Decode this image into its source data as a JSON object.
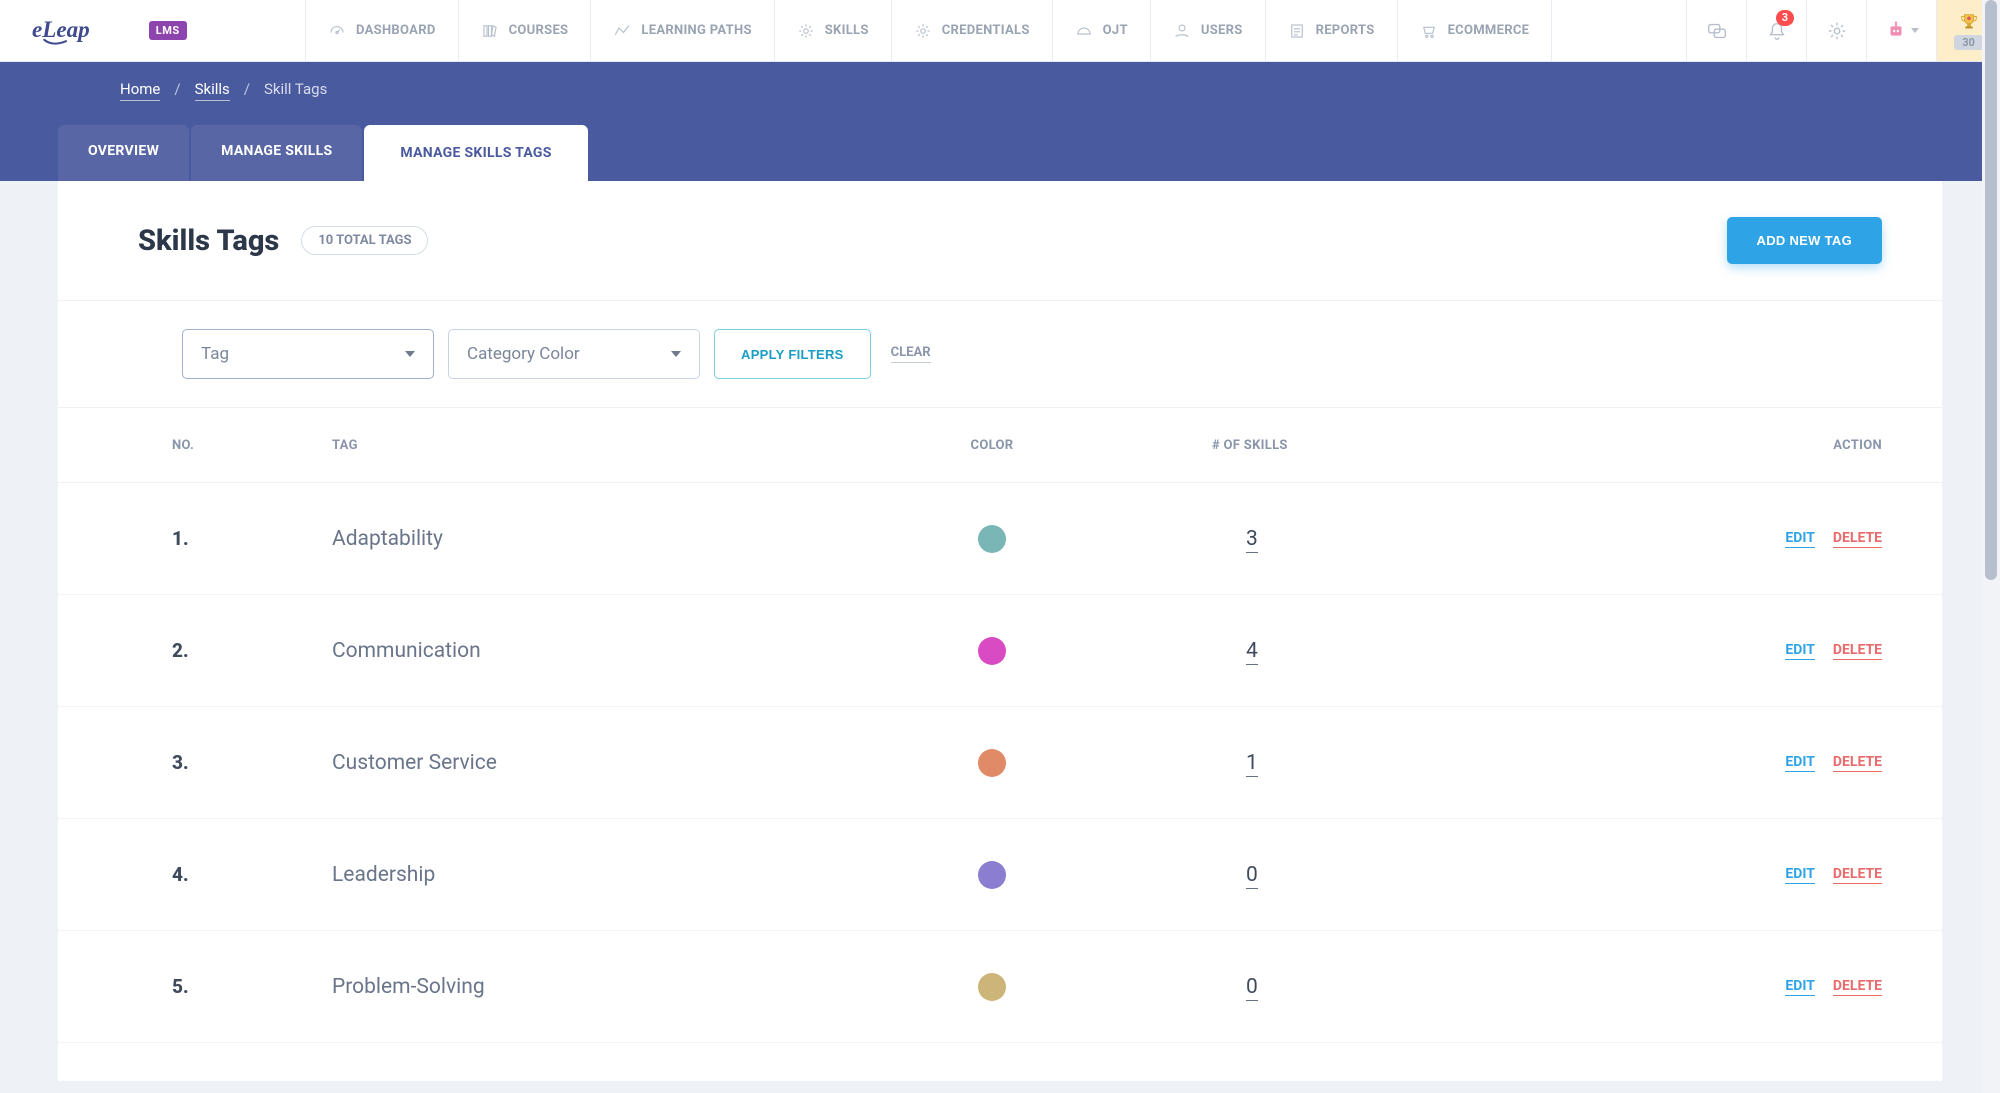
{
  "brand": {
    "lms_badge": "LMS"
  },
  "nav": [
    {
      "label": "DASHBOARD",
      "icon": "gauge-icon"
    },
    {
      "label": "COURSES",
      "icon": "books-icon"
    },
    {
      "label": "LEARNING PATHS",
      "icon": "path-icon"
    },
    {
      "label": "SKILLS",
      "icon": "gear-icon"
    },
    {
      "label": "CREDENTIALS",
      "icon": "gear-icon"
    },
    {
      "label": "OJT",
      "icon": "helmet-icon"
    },
    {
      "label": "USERS",
      "icon": "user-icon"
    },
    {
      "label": "REPORTS",
      "icon": "report-icon"
    },
    {
      "label": "ECOMMERCE",
      "icon": "cart-icon"
    }
  ],
  "notifications_count": "3",
  "trophy_count": "30",
  "breadcrumb": {
    "home": "Home",
    "skills": "Skills",
    "current": "Skill Tags"
  },
  "tabs": {
    "overview": "OVERVIEW",
    "manage_skills": "MANAGE SKILLS",
    "manage_tags": "MANAGE SKILLS TAGS"
  },
  "page": {
    "title": "Skills Tags",
    "count_pill": "10 TOTAL TAGS",
    "add_button": "ADD NEW TAG"
  },
  "filters": {
    "tag_placeholder": "Tag",
    "color_placeholder": "Category Color",
    "apply": "APPLY FILTERS",
    "clear": "CLEAR"
  },
  "table": {
    "headers": {
      "no": "NO.",
      "tag": "TAG",
      "color": "COLOR",
      "skills": "# OF SKILLS",
      "action": "ACTION"
    },
    "edit_label": "EDIT",
    "delete_label": "DELETE",
    "rows": [
      {
        "no": "1.",
        "tag": "Adaptability",
        "color": "#7ab6b6",
        "skills": "3"
      },
      {
        "no": "2.",
        "tag": "Communication",
        "color": "#d94bc2",
        "skills": "4"
      },
      {
        "no": "3.",
        "tag": "Customer Service",
        "color": "#e08a68",
        "skills": "1"
      },
      {
        "no": "4.",
        "tag": "Leadership",
        "color": "#8b7ed1",
        "skills": "0"
      },
      {
        "no": "5.",
        "tag": "Problem-Solving",
        "color": "#cdb579",
        "skills": "0"
      }
    ]
  }
}
